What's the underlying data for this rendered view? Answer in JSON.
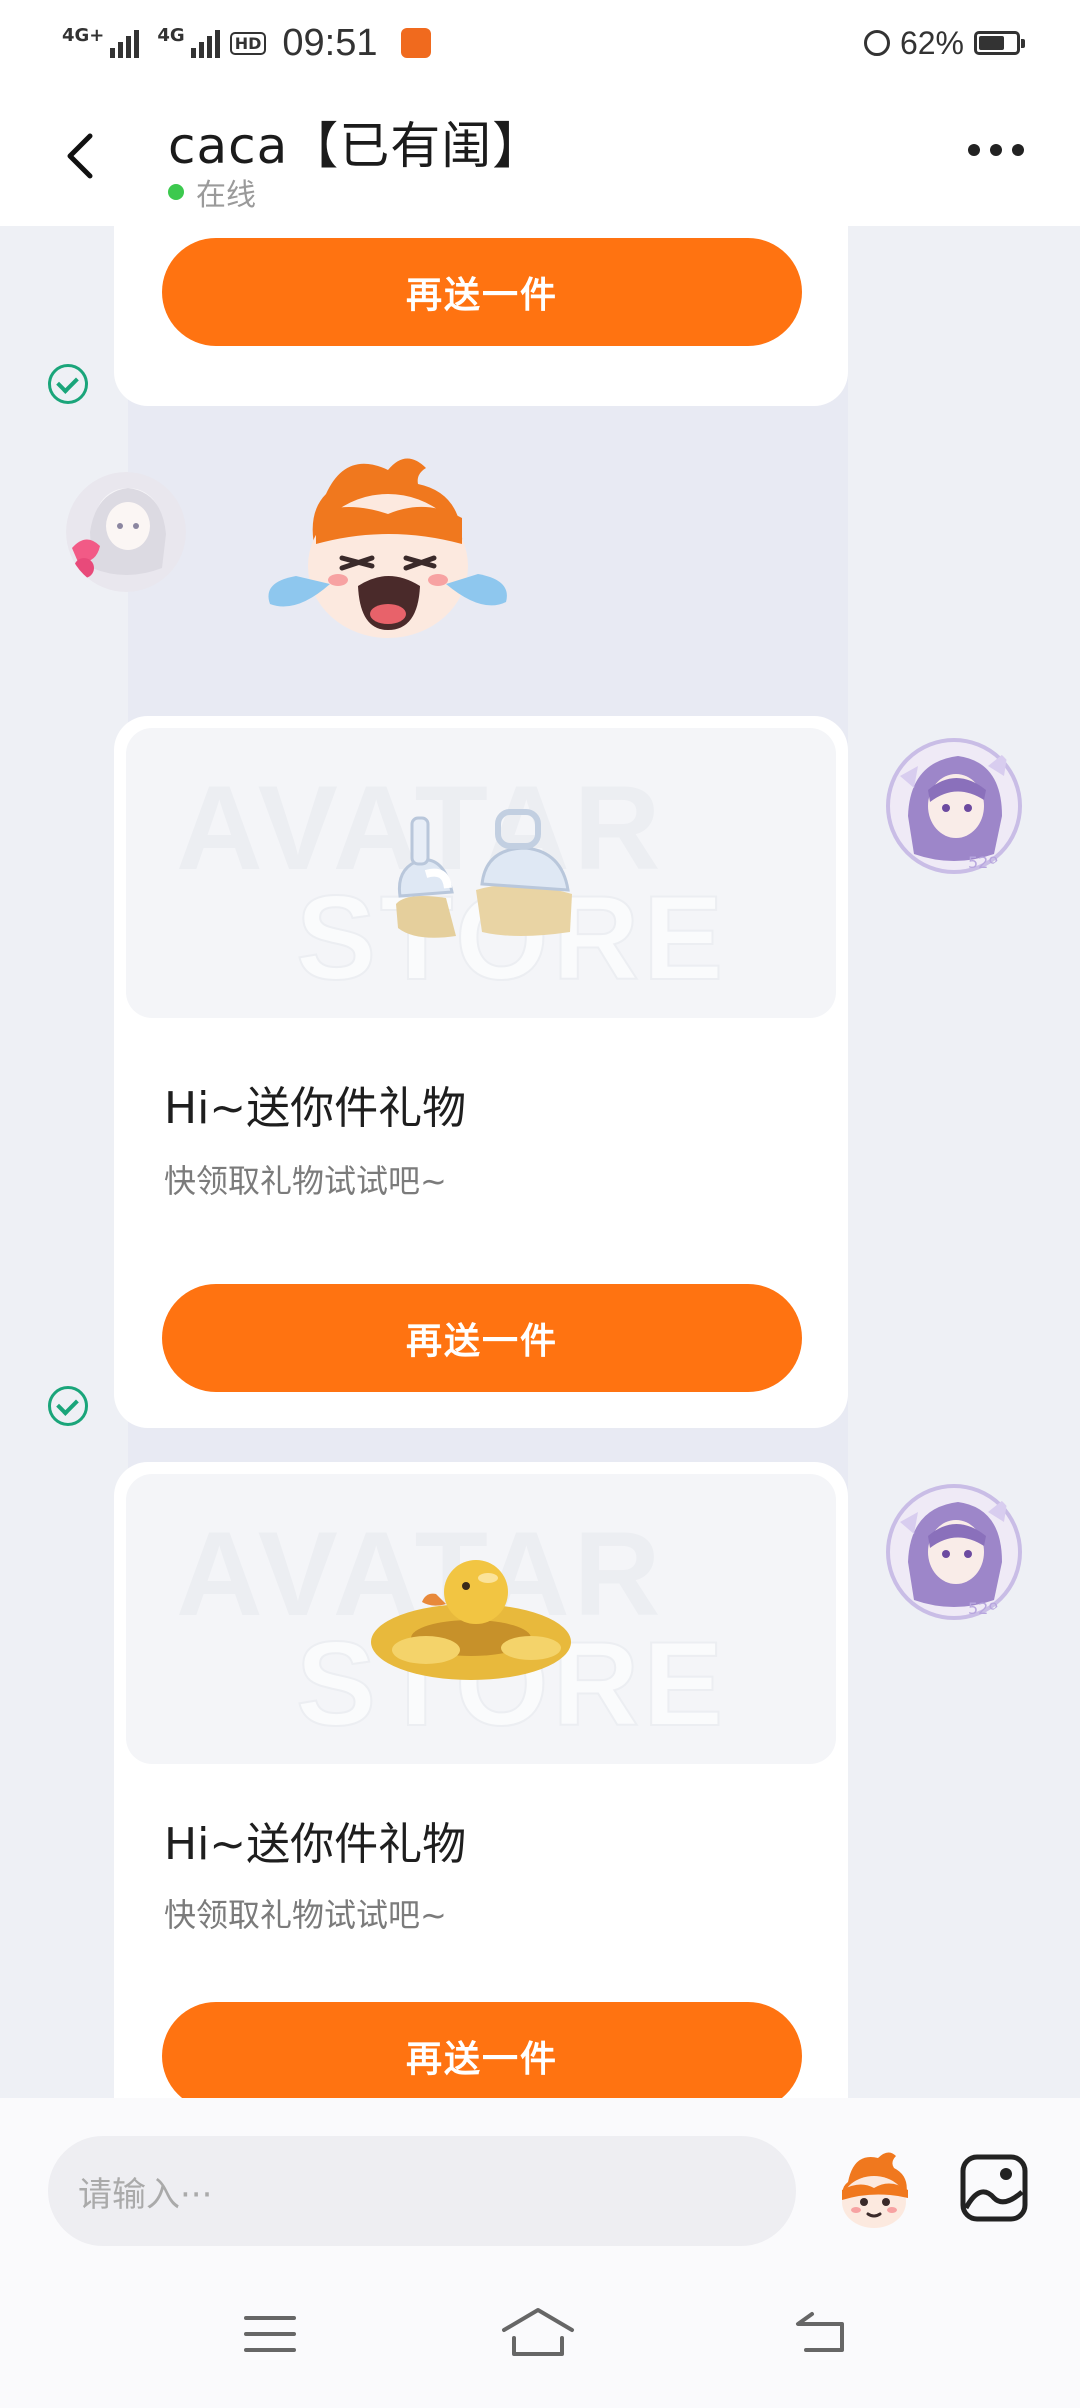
{
  "status_bar": {
    "network_1": "4G+",
    "network_2": "4G",
    "hd_label": "HD",
    "time": "09:51",
    "battery_text": "62%",
    "battery_level": 0.62,
    "icons": [
      "signal-icon",
      "signal-icon",
      "hd-icon",
      "app-notification-icon",
      "alarm-icon",
      "battery-icon"
    ]
  },
  "header": {
    "contact_name": "caca【已有闺】",
    "status": "在线",
    "icons": [
      "back-icon",
      "more-icon"
    ]
  },
  "messages": {
    "gift_title": "Hi~送你件礼物",
    "gift_subtitle": "快领取礼物试试吧~",
    "resend_label": "再送一件",
    "watermark_line1": "AVATAR",
    "watermark_line2": "STORE",
    "avatar_badge": "529",
    "items": [
      {
        "type": "gift-card-partial",
        "button": "再送一件",
        "delivered": true
      },
      {
        "type": "sticker",
        "from": "contact",
        "sticker": "crying-mascot"
      },
      {
        "type": "gift-card",
        "item": "sandals",
        "title": "Hi~送你件礼物",
        "subtitle": "快领取礼物试试吧~",
        "button": "再送一件",
        "delivered": true
      },
      {
        "type": "gift-card",
        "item": "rubber-duck-float",
        "title": "Hi~送你件礼物",
        "subtitle": "快领取礼物试试吧~",
        "button": "再送一件"
      }
    ]
  },
  "composer": {
    "placeholder": "请输入···",
    "icons": [
      "emoji-icon",
      "image-icon"
    ]
  },
  "nav_bar": {
    "icons": [
      "menu-icon",
      "home-icon",
      "back-nav-icon"
    ]
  },
  "colors": {
    "accent": "#ff7311",
    "online": "#3cc94e",
    "delivered": "#1aa57a",
    "chat_bg": "#eef0f5"
  }
}
